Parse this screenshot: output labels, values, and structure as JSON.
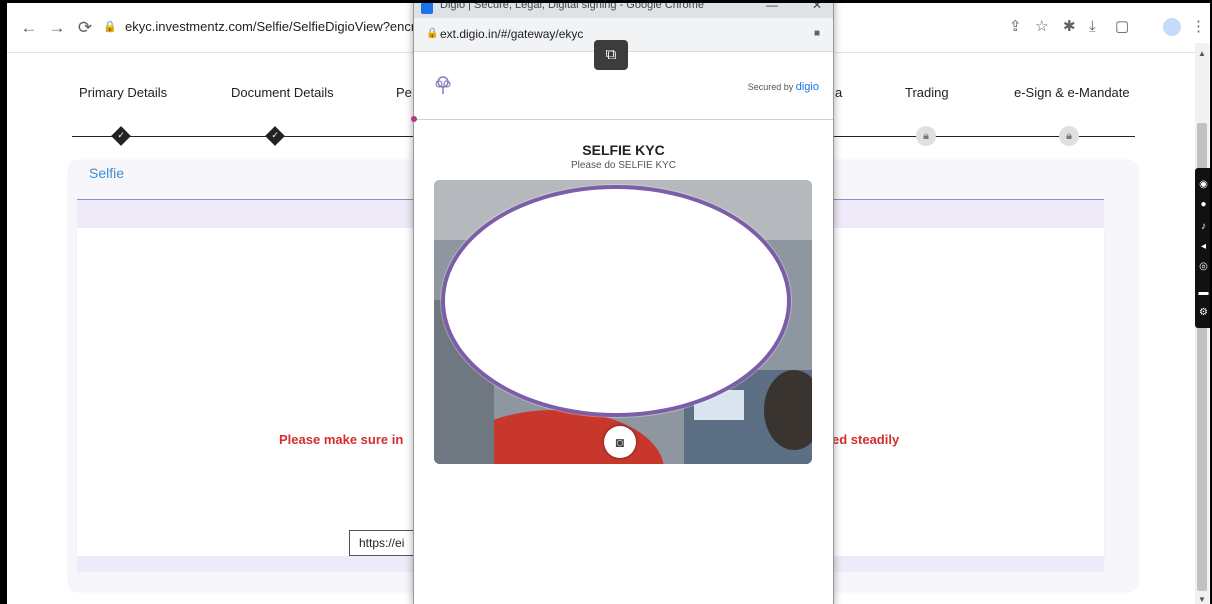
{
  "browser": {
    "url": "ekyc.investmentz.com/Selfie/SelfieDigioView?encre"
  },
  "stepper": {
    "steps": [
      {
        "label": "Primary Details",
        "status": "done"
      },
      {
        "label": "Document Details",
        "status": "done"
      },
      {
        "label": "Pe",
        "status": "current"
      },
      {
        "label": "a",
        "status": "locked"
      },
      {
        "label": "Trading",
        "status": "locked"
      },
      {
        "label": "e-Sign & e-Mandate",
        "status": "locked"
      }
    ]
  },
  "card": {
    "title": "Selfie",
    "warning_left": "Please make sure in",
    "warning_right": "ed steadily",
    "url_field_value": "https://ei"
  },
  "popup": {
    "window_title": "Digio | Secure, Legal, Digital signing - Google Chrome",
    "url": "ext.digio.in/#/gateway/ekyc",
    "secured_prefix": "Secured by",
    "secured_brand": "digio",
    "title": "SELFIE KYC",
    "subtitle": "Please do SELFIE KYC"
  },
  "colors": {
    "accent": "#3d8fd1",
    "warning": "#d32f2f",
    "oval_border": "#7b5ea7"
  }
}
